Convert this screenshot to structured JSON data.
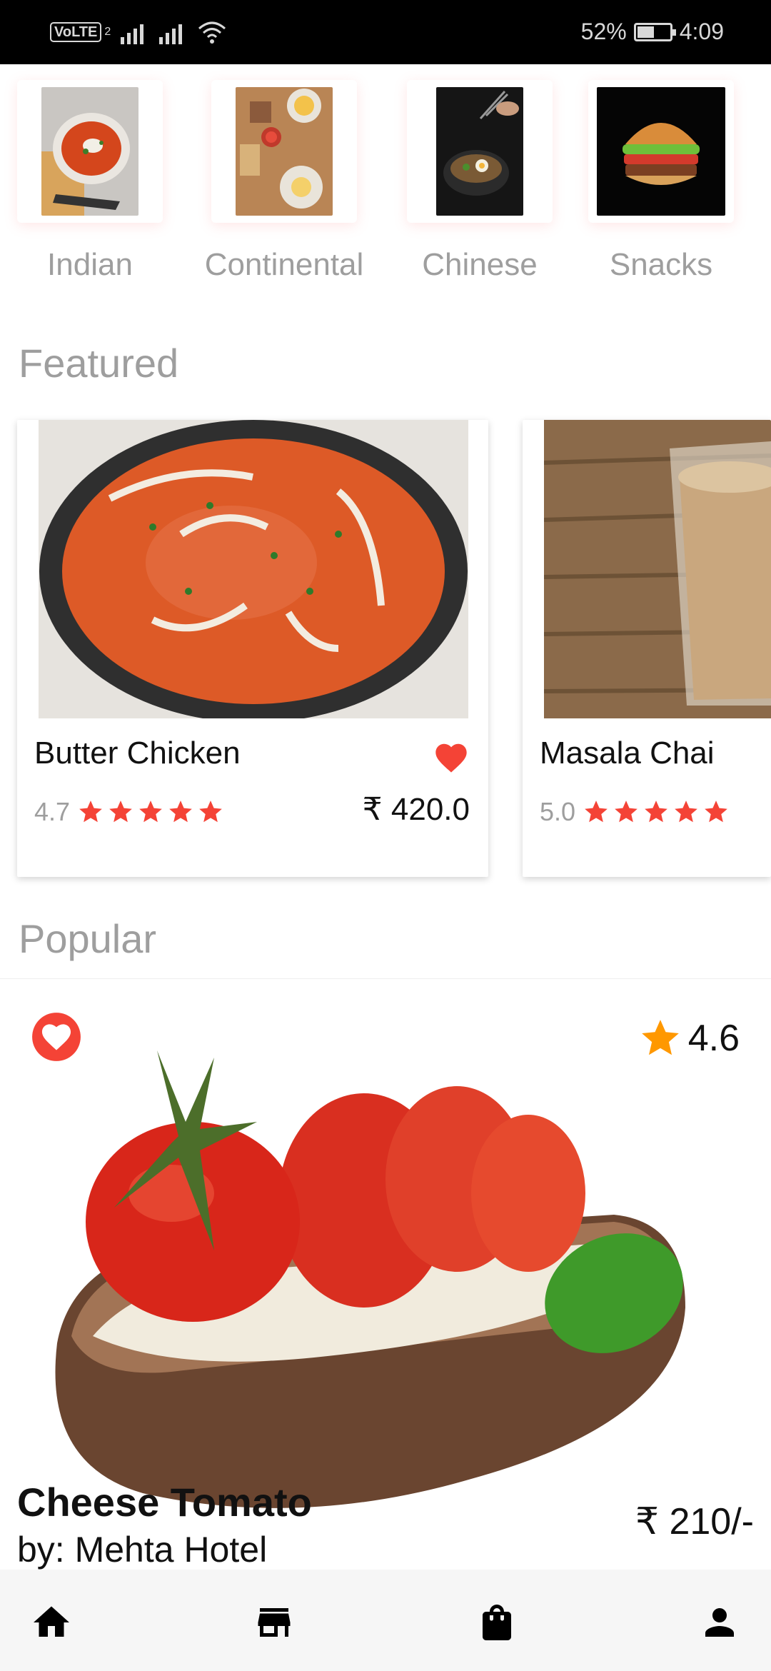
{
  "status_bar": {
    "volte": "VoLTE",
    "volte_sub": "2",
    "battery_percent": "52%",
    "battery_level": 0.52,
    "time": "4:09"
  },
  "categories": [
    {
      "label": "Indian"
    },
    {
      "label": "Continental"
    },
    {
      "label": "Chinese"
    },
    {
      "label": "Snacks"
    }
  ],
  "featured": {
    "title": "Featured",
    "items": [
      {
        "name": "Butter Chicken",
        "rating": "4.7",
        "price": "₹ 420.0",
        "favorited": true
      },
      {
        "name": "Masala Chai",
        "rating": "5.0"
      }
    ]
  },
  "popular": {
    "title": "Popular",
    "item": {
      "name": "Cheese Tomato",
      "vendor": "by: Mehta Hotel",
      "rating": "4.6",
      "price": "₹ 210/-"
    }
  },
  "bottom_nav": [
    "home-icon",
    "store-icon",
    "shopping-bag-icon",
    "account-icon"
  ],
  "colors": {
    "accent_red": "#f44336",
    "star_orange": "#ff9800",
    "muted_text": "#9e9e9e"
  }
}
